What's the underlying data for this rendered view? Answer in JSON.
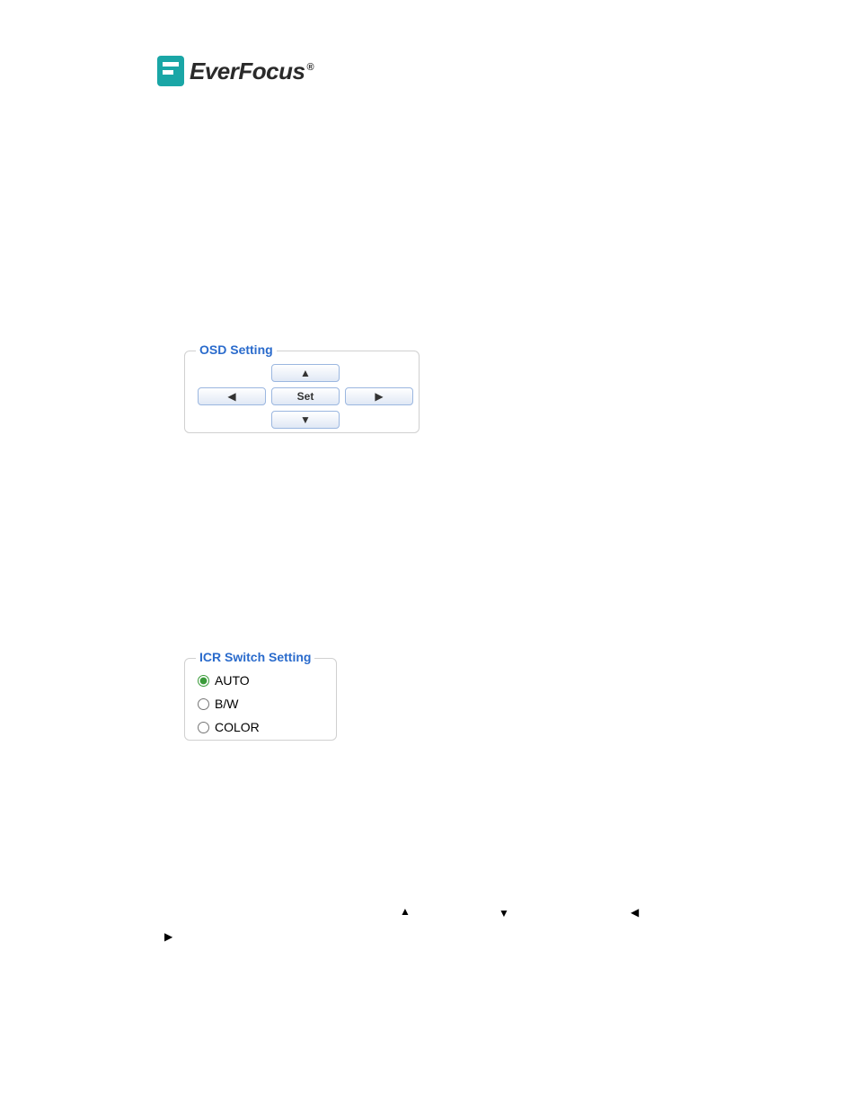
{
  "brand": {
    "name": "EverFocus",
    "registered": "®"
  },
  "osd": {
    "legend": "OSD Setting",
    "up": "▲",
    "down": "▼",
    "left": "◀",
    "right": "▶",
    "set": "Set"
  },
  "icr": {
    "legend": "ICR Switch Setting",
    "options": {
      "auto": "AUTO",
      "bw": "B/W",
      "color": "COLOR"
    },
    "selected": "auto"
  },
  "inline_arrows": {
    "up": "▲",
    "down": "▼",
    "left": "◀",
    "right": "▶"
  }
}
